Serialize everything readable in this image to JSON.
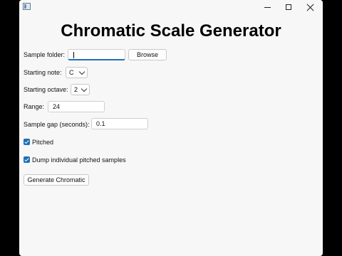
{
  "window": {
    "app_icon": "window-app-icon",
    "controls": [
      "minimize-icon",
      "maximize-icon",
      "close-icon"
    ]
  },
  "main": {
    "title": "Chromatic Scale Generator",
    "sample_folder": {
      "label": "Sample folder:",
      "value": "",
      "browse_label": "Browse"
    },
    "starting_note": {
      "label": "Starting note:",
      "selected": "C"
    },
    "starting_octave": {
      "label": "Starting octave:",
      "selected": "2"
    },
    "range": {
      "label": "Range:",
      "value": "24"
    },
    "sample_gap": {
      "label": "Sample gap (seconds):",
      "value": "0.1"
    },
    "pitched": {
      "label": "Pitched",
      "checked": true
    },
    "dump_samples": {
      "label": "Dump individual pitched samples",
      "checked": true
    },
    "generate_label": "Generate Chromatic"
  },
  "colors": {
    "accent": "#1f6fb5",
    "window_bg": "#f7f7f7",
    "backdrop": "#000000"
  }
}
